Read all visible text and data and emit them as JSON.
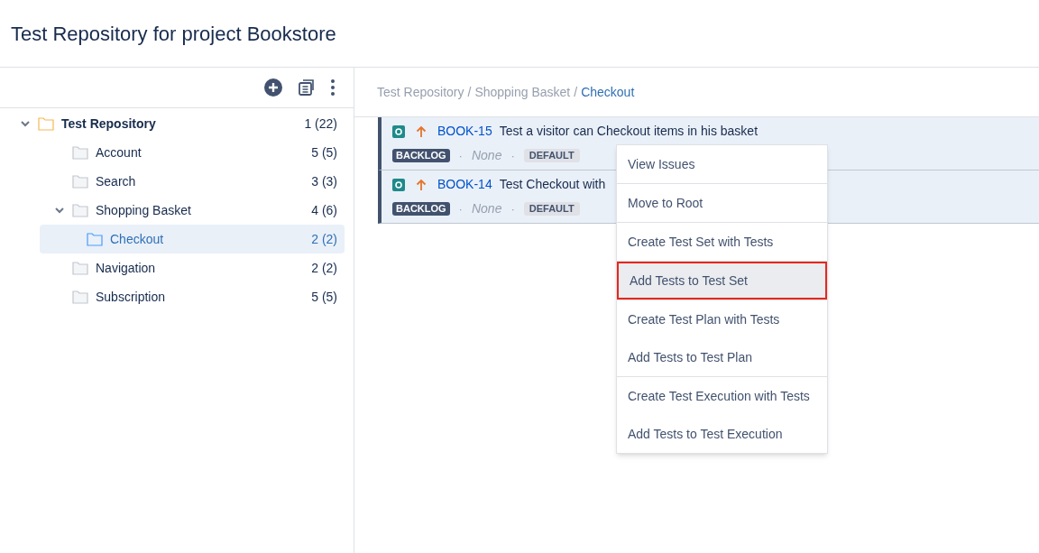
{
  "page_title": "Test Repository for project Bookstore",
  "tree": [
    {
      "label": "Test Repository",
      "count": "1 (22)",
      "kind": "root",
      "expanded": true,
      "selected": false,
      "children": [
        {
          "label": "Account",
          "count": "5 (5)",
          "kind": "folder",
          "selected": false
        },
        {
          "label": "Search",
          "count": "3 (3)",
          "kind": "folder",
          "selected": false
        },
        {
          "label": "Shopping Basket",
          "count": "4 (6)",
          "kind": "folder",
          "expanded": true,
          "selected": false,
          "children": [
            {
              "label": "Checkout",
              "count": "2 (2)",
              "kind": "folder",
              "selected": true
            }
          ]
        },
        {
          "label": "Navigation",
          "count": "2 (2)",
          "kind": "folder",
          "selected": false
        },
        {
          "label": "Subscription",
          "count": "5 (5)",
          "kind": "folder",
          "selected": false
        }
      ]
    }
  ],
  "breadcrumb": [
    {
      "label": "Test Repository"
    },
    {
      "separator": "/",
      "label": "Shopping Basket"
    },
    {
      "separator": "/",
      "label": "Checkout"
    }
  ],
  "tests": [
    {
      "key": "BOOK-15",
      "title": "Test a visitor can Checkout items in his basket",
      "status": "BACKLOG",
      "separators": [
        "·",
        "·"
      ],
      "assignee": "None",
      "label": "DEFAULT"
    },
    {
      "key": "BOOK-14",
      "title": "Test Checkout with",
      "status": "BACKLOG",
      "separators": [
        "·",
        "·"
      ],
      "assignee": "None",
      "label": "DEFAULT"
    }
  ],
  "context_menu": [
    [
      {
        "label": "View Issues",
        "selected": false
      }
    ],
    [
      {
        "label": "Move to Root",
        "selected": false
      }
    ],
    [
      {
        "label": "Create Test Set with Tests",
        "selected": false
      }
    ],
    [
      {
        "label": "Add Tests to Test Set",
        "selected": true
      }
    ],
    [
      {
        "label": "Create Test Plan with Tests",
        "selected": false
      },
      {
        "label": "Add Tests to Test Plan",
        "selected": false
      }
    ],
    [
      {
        "label": "Create Test Execution with Tests",
        "selected": false
      },
      {
        "label": "Add Tests to Test Execution",
        "selected": false
      }
    ]
  ]
}
